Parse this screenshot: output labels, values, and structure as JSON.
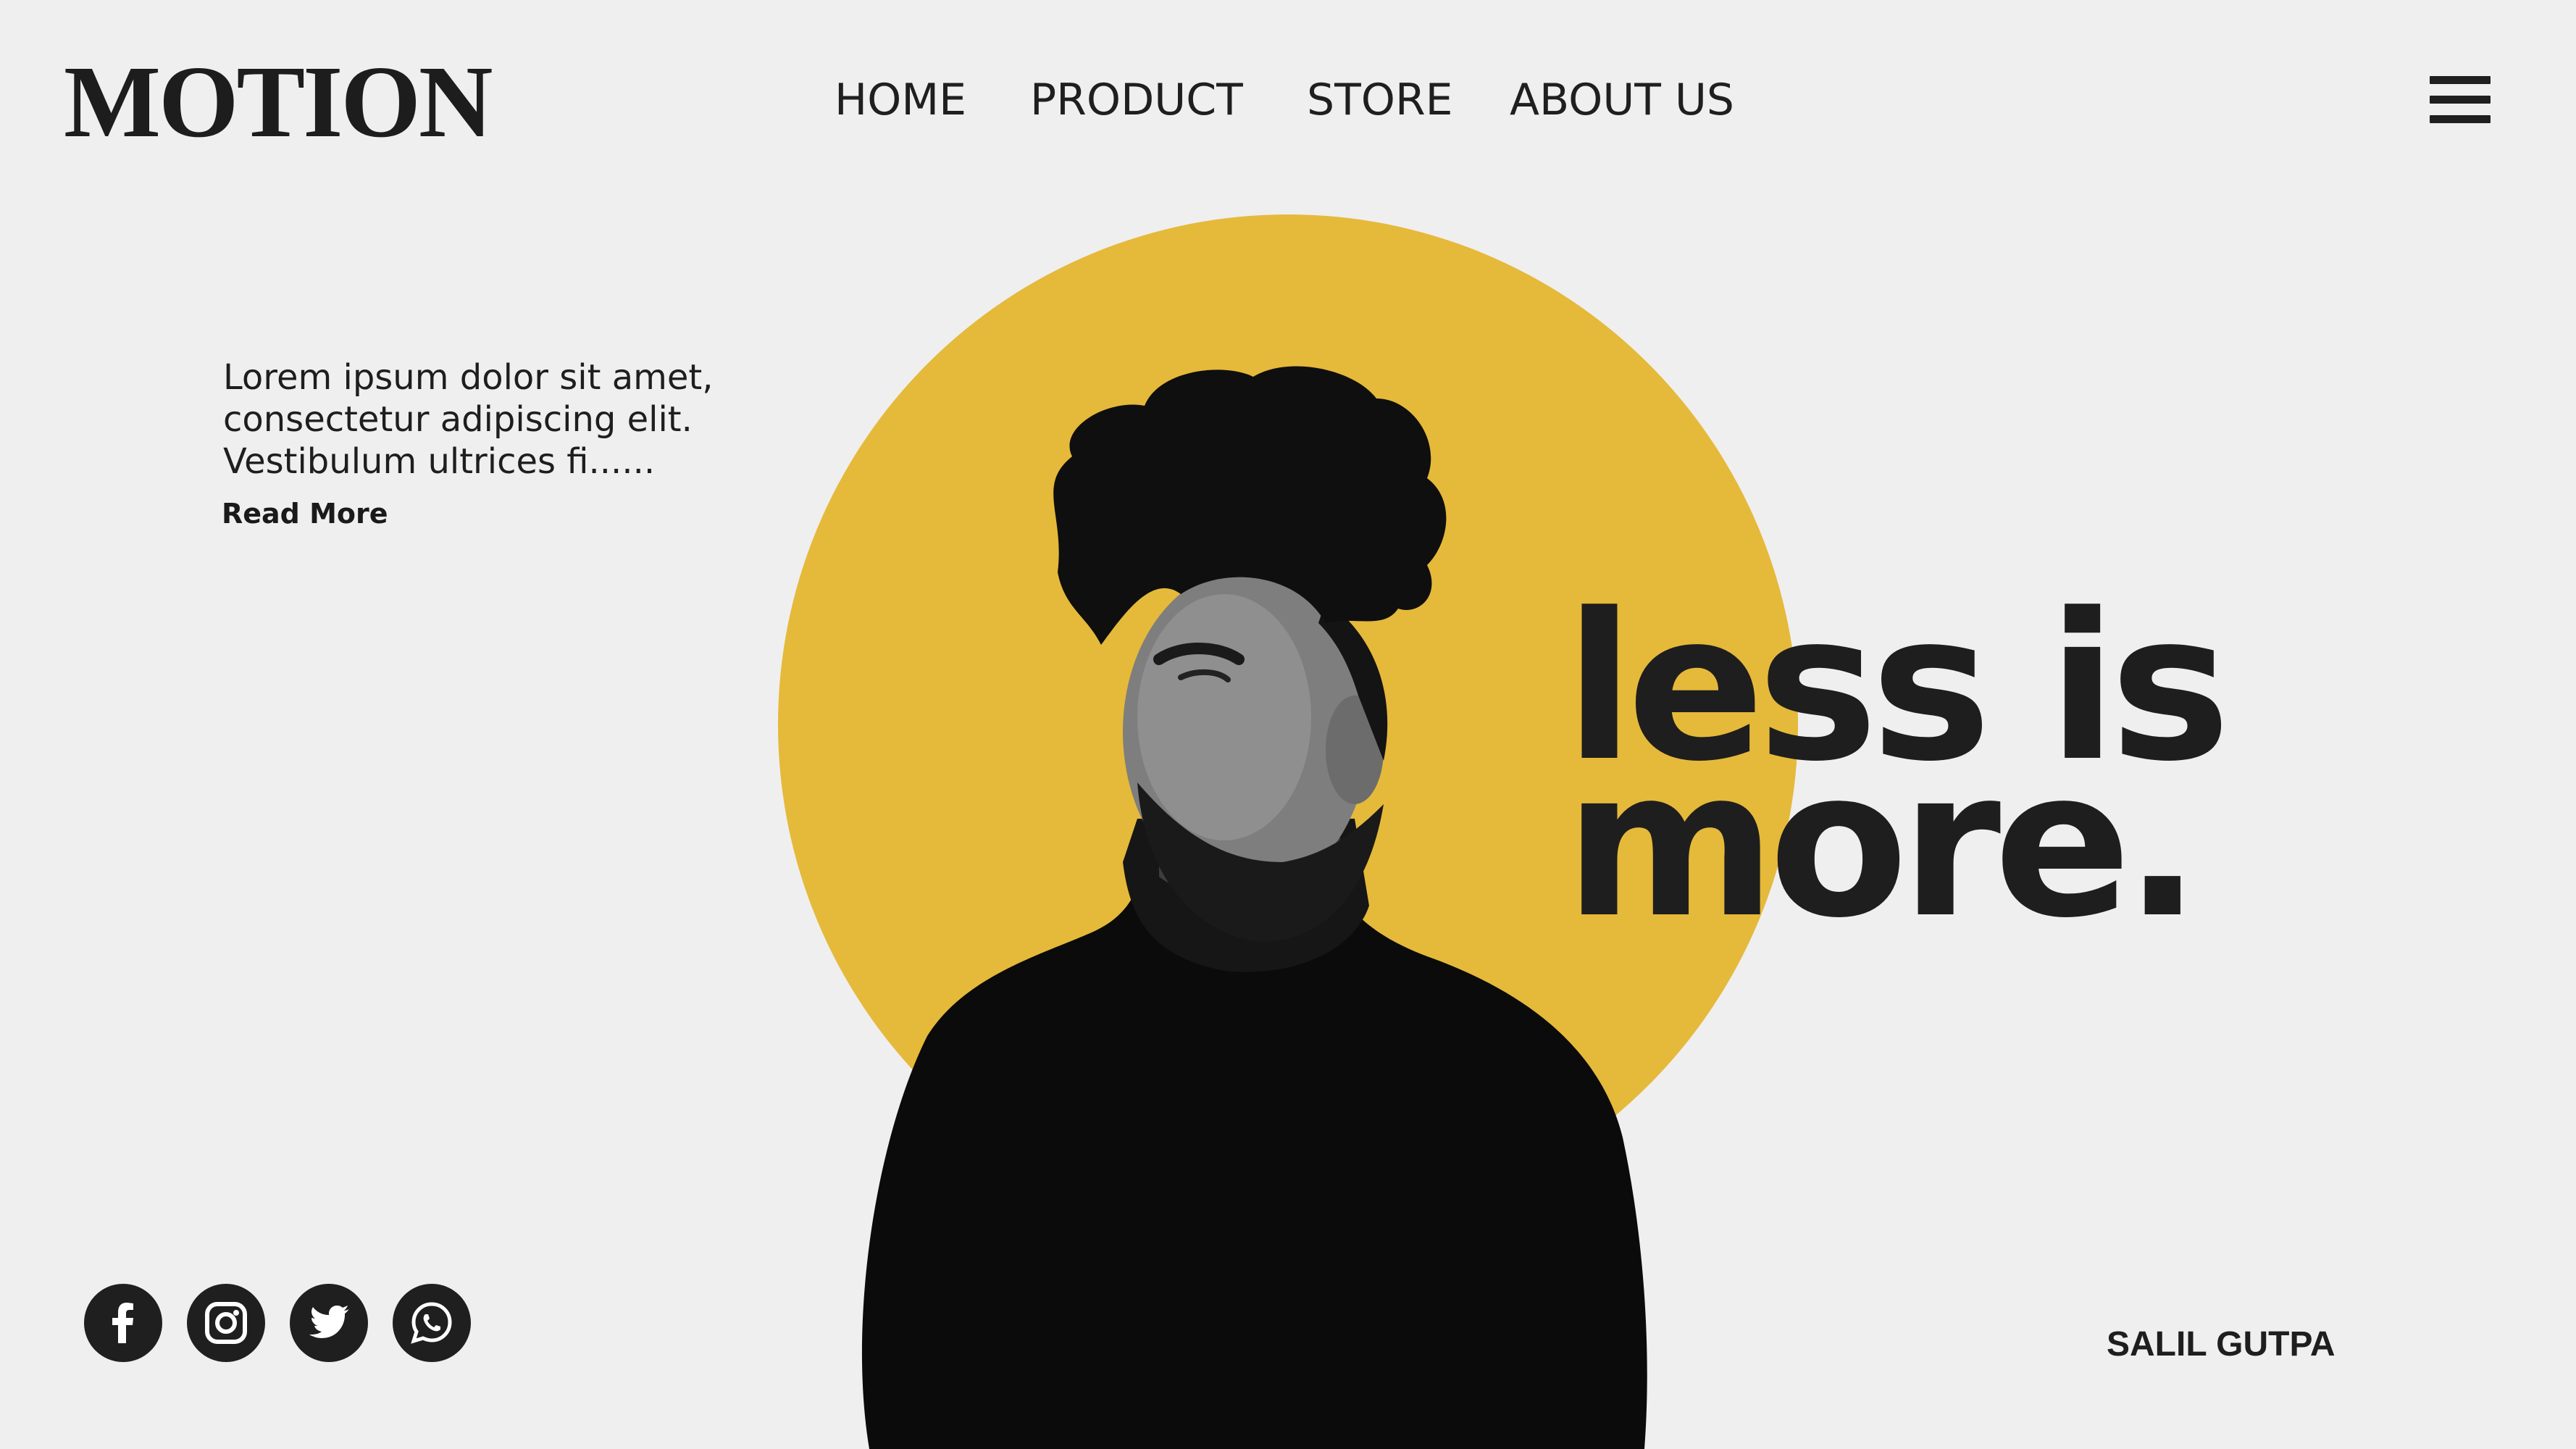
{
  "brand": {
    "logo": "MOTION"
  },
  "nav": {
    "items": [
      {
        "label": "HOME"
      },
      {
        "label": "PRODUCT"
      },
      {
        "label": "STORE"
      },
      {
        "label": "ABOUT US"
      }
    ],
    "menu_icon": "hamburger-menu-icon"
  },
  "intro": {
    "lines": [
      "Lorem ipsum dolor sit amet,",
      "consectetur adipiscing elit.",
      "Vestibulum ultrices fi......"
    ],
    "read_more": "Read More"
  },
  "hero": {
    "headline_line1": "less is",
    "headline_line2": "more.",
    "accent_color": "#e5b93a",
    "image": "black-and-white portrait of a bearded man in a black turtleneck"
  },
  "social": [
    {
      "icon": "facebook-icon"
    },
    {
      "icon": "instagram-icon"
    },
    {
      "icon": "twitter-icon"
    },
    {
      "icon": "whatsapp-icon"
    }
  ],
  "footer": {
    "author": "SALIL GUTPA"
  },
  "colors": {
    "background": "#efefef",
    "text": "#1e1e1e",
    "accent": "#e5b93a"
  }
}
